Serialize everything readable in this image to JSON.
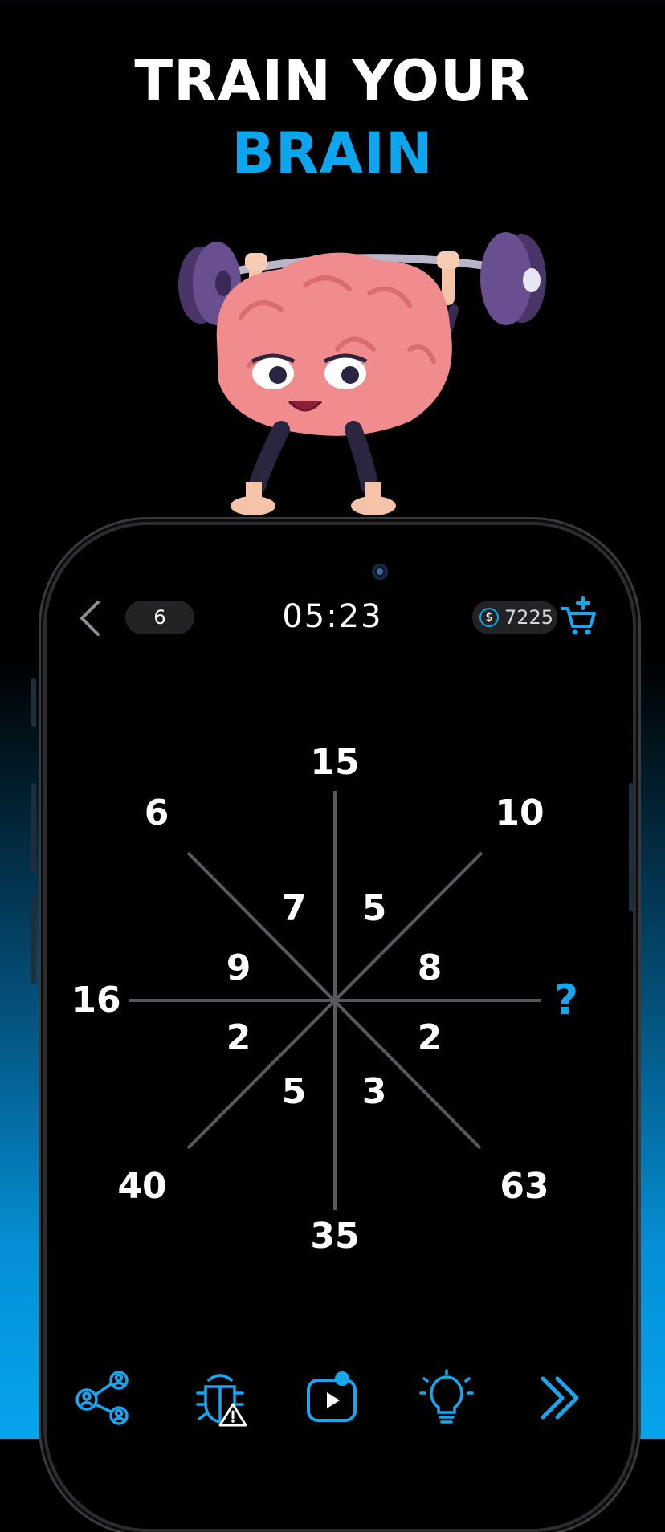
{
  "headline": {
    "line1": "TRAIN YOUR",
    "line2": "BRAIN"
  },
  "colors": {
    "accent": "#0ea5ef",
    "text": "#ffffff",
    "line": "#5a5a5e",
    "pill": "#232325"
  },
  "status": {
    "back_icon": "chevron-left-icon",
    "level": "6",
    "timer": "05:23",
    "coin_symbol": "$",
    "coins": "7225",
    "cart_icon": "add-to-cart-icon"
  },
  "puzzle": {
    "outer": {
      "top": "15",
      "top_left": "6",
      "top_right": "10",
      "left": "16",
      "right": "?",
      "bottom_left": "40",
      "bottom_right": "63",
      "bottom": "35"
    },
    "inner": {
      "a": "7",
      "b": "5",
      "c": "9",
      "d": "8",
      "e": "2",
      "f": "2",
      "g": "5",
      "h": "3"
    }
  },
  "toolbar": [
    {
      "name": "share",
      "icon": "share-people-icon"
    },
    {
      "name": "report-bug",
      "icon": "bug-warning-icon"
    },
    {
      "name": "watch-video",
      "icon": "video-play-icon"
    },
    {
      "name": "hint",
      "icon": "lightbulb-icon"
    },
    {
      "name": "skip",
      "icon": "double-chevron-right-icon"
    }
  ]
}
